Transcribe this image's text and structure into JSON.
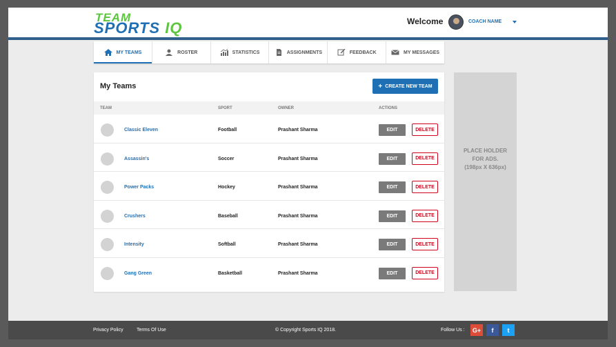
{
  "header": {
    "logo_top": "TEAM",
    "logo_sports": "SPORTS",
    "logo_iq": "IQ",
    "welcome": "Welcome",
    "user_name": "COACH NAME"
  },
  "nav": [
    {
      "label": "MY TEAMS",
      "icon": "home-icon",
      "active": true
    },
    {
      "label": "ROSTER",
      "icon": "user-icon"
    },
    {
      "label": "STATISTICS",
      "icon": "chart-icon"
    },
    {
      "label": "ASSIGNMENTS",
      "icon": "document-icon"
    },
    {
      "label": "FEEDBACK",
      "icon": "edit-icon"
    },
    {
      "label": "MY MESSAGES",
      "icon": "envelope-icon"
    }
  ],
  "panel": {
    "title": "My Teams",
    "create_button": "CREATE NEW TEAM",
    "columns": [
      "TEAM",
      "SPORT",
      "OWNER",
      "ACTIONS"
    ],
    "edit_label": "EDIT",
    "delete_label": "DELETE",
    "rows": [
      {
        "team": "Classic Eleven",
        "sport": "Football",
        "owner": "Prashant Sharma"
      },
      {
        "team": "Assassin's",
        "sport": "Soccer",
        "owner": "Prashant Sharma"
      },
      {
        "team": "Power Packs",
        "sport": "Hockey",
        "owner": "Prashant Sharma"
      },
      {
        "team": "Crushers",
        "sport": "Baseball",
        "owner": "Prashant Sharma"
      },
      {
        "team": "Intensity",
        "sport": "Softball",
        "owner": "Prashant Sharma"
      },
      {
        "team": "Gang Green",
        "sport": "Basketball",
        "owner": "Prashant Sharma"
      }
    ]
  },
  "ads": {
    "line1": "PLACE HOLDER",
    "line2": "FOR ADS.",
    "line3": "(198px X 636px)"
  },
  "footer": {
    "privacy": "Privacy Policy",
    "terms": "Terms Of Use",
    "copyright": "© Copyright Sports IQ 2018.",
    "follow": "Follow Us :",
    "gplus": "G+",
    "facebook": "f",
    "twitter": "t"
  },
  "colors": {
    "brand_blue": "#1f6fb5",
    "brand_green": "#5cc63f",
    "delete_red": "#d0021b"
  }
}
